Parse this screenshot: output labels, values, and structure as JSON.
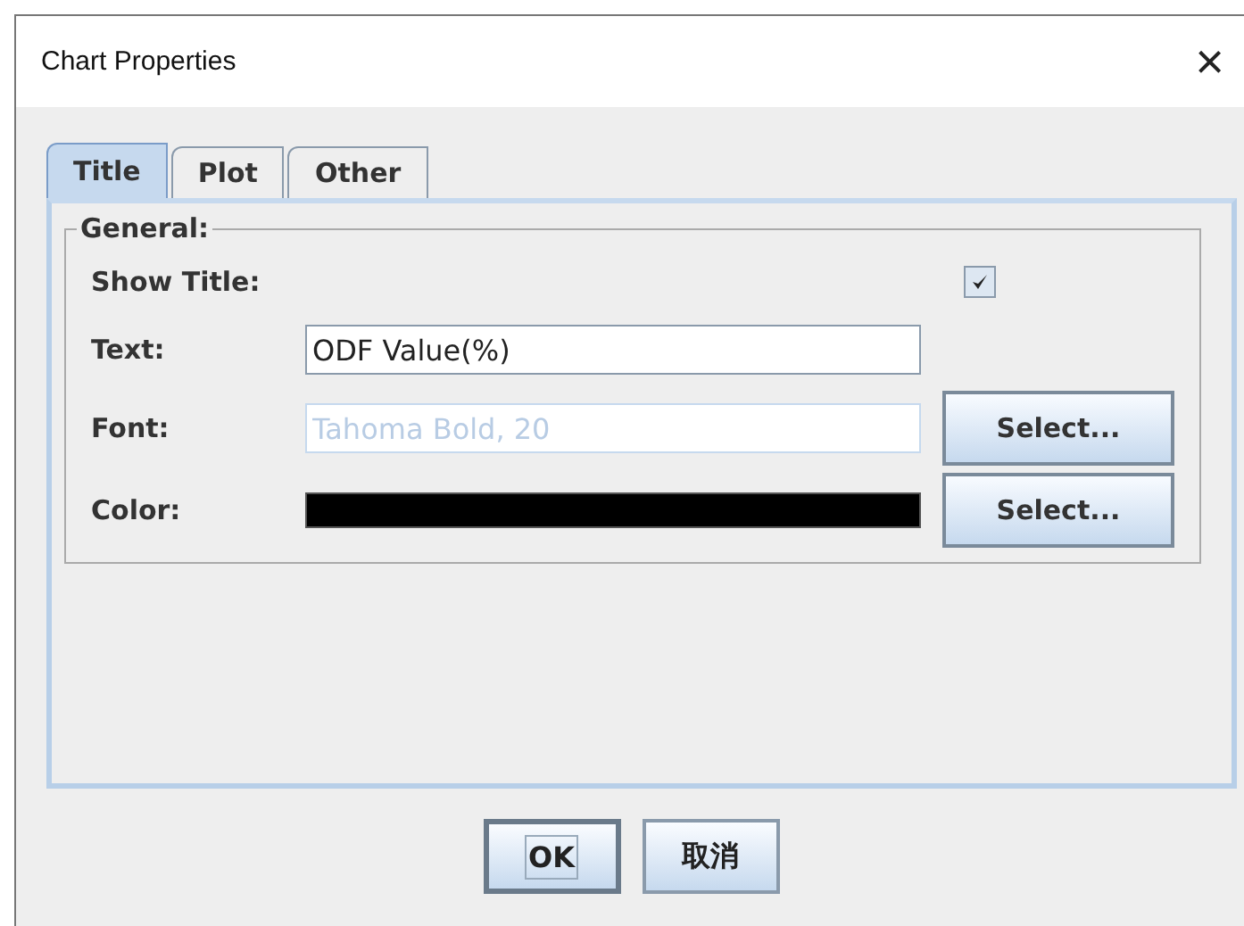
{
  "window": {
    "title": "Chart Properties",
    "close": "×"
  },
  "tabs": [
    {
      "label": "Title",
      "selected": true
    },
    {
      "label": "Plot",
      "selected": false
    },
    {
      "label": "Other",
      "selected": false
    }
  ],
  "group": {
    "title": "General:",
    "show_title": {
      "label": "Show Title:",
      "checked": true
    },
    "text": {
      "label": "Text:",
      "value": "ODF Value(%)"
    },
    "font": {
      "label": "Font:",
      "value": "Tahoma Bold, 20",
      "disabled": true,
      "button": "Select..."
    },
    "color": {
      "label": "Color:",
      "color": "#000000",
      "button": "Select..."
    }
  },
  "buttons": [
    {
      "label": "OK",
      "focused": true
    },
    {
      "label": "取消",
      "focused": false
    }
  ]
}
